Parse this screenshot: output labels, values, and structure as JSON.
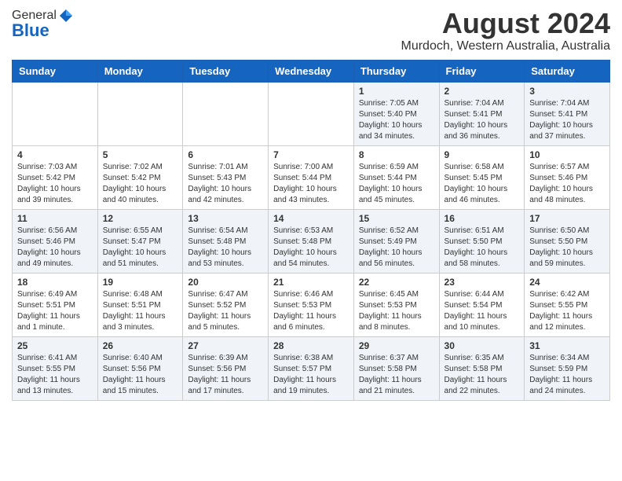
{
  "header": {
    "logo_general": "General",
    "logo_blue": "Blue",
    "title": "August 2024",
    "subtitle": "Murdoch, Western Australia, Australia"
  },
  "calendar": {
    "days_of_week": [
      "Sunday",
      "Monday",
      "Tuesday",
      "Wednesday",
      "Thursday",
      "Friday",
      "Saturday"
    ],
    "weeks": [
      [
        {
          "day": "",
          "info": ""
        },
        {
          "day": "",
          "info": ""
        },
        {
          "day": "",
          "info": ""
        },
        {
          "day": "",
          "info": ""
        },
        {
          "day": "1",
          "info": "Sunrise: 7:05 AM\nSunset: 5:40 PM\nDaylight: 10 hours\nand 34 minutes."
        },
        {
          "day": "2",
          "info": "Sunrise: 7:04 AM\nSunset: 5:41 PM\nDaylight: 10 hours\nand 36 minutes."
        },
        {
          "day": "3",
          "info": "Sunrise: 7:04 AM\nSunset: 5:41 PM\nDaylight: 10 hours\nand 37 minutes."
        }
      ],
      [
        {
          "day": "4",
          "info": "Sunrise: 7:03 AM\nSunset: 5:42 PM\nDaylight: 10 hours\nand 39 minutes."
        },
        {
          "day": "5",
          "info": "Sunrise: 7:02 AM\nSunset: 5:42 PM\nDaylight: 10 hours\nand 40 minutes."
        },
        {
          "day": "6",
          "info": "Sunrise: 7:01 AM\nSunset: 5:43 PM\nDaylight: 10 hours\nand 42 minutes."
        },
        {
          "day": "7",
          "info": "Sunrise: 7:00 AM\nSunset: 5:44 PM\nDaylight: 10 hours\nand 43 minutes."
        },
        {
          "day": "8",
          "info": "Sunrise: 6:59 AM\nSunset: 5:44 PM\nDaylight: 10 hours\nand 45 minutes."
        },
        {
          "day": "9",
          "info": "Sunrise: 6:58 AM\nSunset: 5:45 PM\nDaylight: 10 hours\nand 46 minutes."
        },
        {
          "day": "10",
          "info": "Sunrise: 6:57 AM\nSunset: 5:46 PM\nDaylight: 10 hours\nand 48 minutes."
        }
      ],
      [
        {
          "day": "11",
          "info": "Sunrise: 6:56 AM\nSunset: 5:46 PM\nDaylight: 10 hours\nand 49 minutes."
        },
        {
          "day": "12",
          "info": "Sunrise: 6:55 AM\nSunset: 5:47 PM\nDaylight: 10 hours\nand 51 minutes."
        },
        {
          "day": "13",
          "info": "Sunrise: 6:54 AM\nSunset: 5:48 PM\nDaylight: 10 hours\nand 53 minutes."
        },
        {
          "day": "14",
          "info": "Sunrise: 6:53 AM\nSunset: 5:48 PM\nDaylight: 10 hours\nand 54 minutes."
        },
        {
          "day": "15",
          "info": "Sunrise: 6:52 AM\nSunset: 5:49 PM\nDaylight: 10 hours\nand 56 minutes."
        },
        {
          "day": "16",
          "info": "Sunrise: 6:51 AM\nSunset: 5:50 PM\nDaylight: 10 hours\nand 58 minutes."
        },
        {
          "day": "17",
          "info": "Sunrise: 6:50 AM\nSunset: 5:50 PM\nDaylight: 10 hours\nand 59 minutes."
        }
      ],
      [
        {
          "day": "18",
          "info": "Sunrise: 6:49 AM\nSunset: 5:51 PM\nDaylight: 11 hours\nand 1 minute."
        },
        {
          "day": "19",
          "info": "Sunrise: 6:48 AM\nSunset: 5:51 PM\nDaylight: 11 hours\nand 3 minutes."
        },
        {
          "day": "20",
          "info": "Sunrise: 6:47 AM\nSunset: 5:52 PM\nDaylight: 11 hours\nand 5 minutes."
        },
        {
          "day": "21",
          "info": "Sunrise: 6:46 AM\nSunset: 5:53 PM\nDaylight: 11 hours\nand 6 minutes."
        },
        {
          "day": "22",
          "info": "Sunrise: 6:45 AM\nSunset: 5:53 PM\nDaylight: 11 hours\nand 8 minutes."
        },
        {
          "day": "23",
          "info": "Sunrise: 6:44 AM\nSunset: 5:54 PM\nDaylight: 11 hours\nand 10 minutes."
        },
        {
          "day": "24",
          "info": "Sunrise: 6:42 AM\nSunset: 5:55 PM\nDaylight: 11 hours\nand 12 minutes."
        }
      ],
      [
        {
          "day": "25",
          "info": "Sunrise: 6:41 AM\nSunset: 5:55 PM\nDaylight: 11 hours\nand 13 minutes."
        },
        {
          "day": "26",
          "info": "Sunrise: 6:40 AM\nSunset: 5:56 PM\nDaylight: 11 hours\nand 15 minutes."
        },
        {
          "day": "27",
          "info": "Sunrise: 6:39 AM\nSunset: 5:56 PM\nDaylight: 11 hours\nand 17 minutes."
        },
        {
          "day": "28",
          "info": "Sunrise: 6:38 AM\nSunset: 5:57 PM\nDaylight: 11 hours\nand 19 minutes."
        },
        {
          "day": "29",
          "info": "Sunrise: 6:37 AM\nSunset: 5:58 PM\nDaylight: 11 hours\nand 21 minutes."
        },
        {
          "day": "30",
          "info": "Sunrise: 6:35 AM\nSunset: 5:58 PM\nDaylight: 11 hours\nand 22 minutes."
        },
        {
          "day": "31",
          "info": "Sunrise: 6:34 AM\nSunset: 5:59 PM\nDaylight: 11 hours\nand 24 minutes."
        }
      ]
    ]
  }
}
